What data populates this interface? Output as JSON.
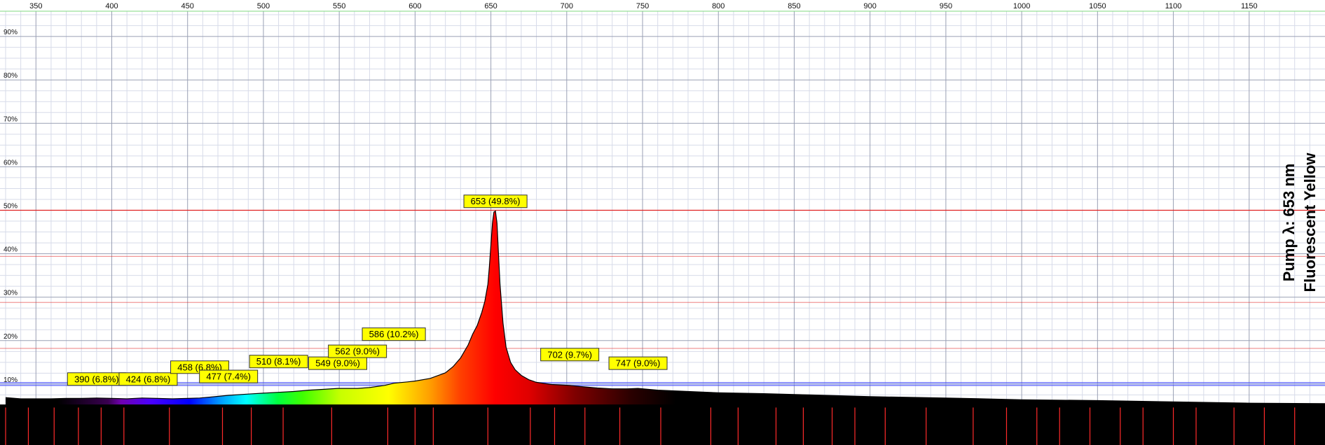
{
  "chart_data": {
    "type": "area",
    "title": "",
    "subtitle_lines": [
      "Pump λ: 653 nm",
      "Fluorescent Yellow"
    ],
    "xlabel": "",
    "ylabel": "",
    "x_axis": {
      "range": [
        330,
        1200
      ],
      "ticks": [
        350,
        400,
        450,
        500,
        550,
        600,
        650,
        700,
        750,
        800,
        850,
        900,
        950,
        1000,
        1050,
        1100,
        1150
      ],
      "tick_labels": [
        "350",
        "400",
        "450",
        "500",
        "550",
        "600",
        "650",
        "700",
        "750",
        "800",
        "850",
        "900",
        "950",
        "1000",
        "1050",
        "1100",
        "1150"
      ],
      "position": "top"
    },
    "y_axis": {
      "range": [
        0,
        100
      ],
      "ticks": [
        10,
        20,
        30,
        40,
        50,
        60,
        70,
        80,
        90
      ],
      "tick_labels": [
        "10%",
        "20%",
        "30%",
        "40%",
        "50%",
        "60%",
        "70%",
        "80%",
        "90%"
      ],
      "position": "left"
    },
    "grid": true,
    "reference_lines": {
      "red": [
        50,
        39.4,
        28.8,
        18.2
      ],
      "blue": [
        10
      ]
    },
    "series": [
      {
        "x": [
          330,
          340,
          350,
          360,
          370,
          380,
          390,
          400,
          410,
          420,
          430,
          440,
          450,
          458,
          465,
          477,
          490,
          500,
          510,
          520,
          530,
          540,
          549,
          555,
          562,
          570,
          580,
          586,
          595,
          600,
          610,
          620,
          625,
          630,
          635,
          638,
          641,
          644,
          646,
          648,
          649,
          650,
          651,
          652,
          653,
          654,
          655,
          656,
          658,
          660,
          663,
          666,
          670,
          675,
          680,
          690,
          702,
          710,
          720,
          730,
          740,
          747,
          760,
          780,
          800,
          830,
          860,
          900,
          950,
          1000,
          1050,
          1100,
          1150,
          1200
        ],
        "y": [
          6.9,
          6.6,
          6.6,
          6.6,
          6.7,
          6.7,
          6.8,
          6.7,
          6.6,
          6.8,
          6.7,
          6.6,
          6.7,
          6.8,
          7.0,
          7.4,
          7.7,
          7.9,
          8.1,
          8.3,
          8.6,
          8.8,
          9.0,
          9.0,
          9.0,
          9.2,
          9.7,
          10.2,
          10.5,
          10.7,
          11.3,
          12.6,
          14.0,
          16.0,
          19.0,
          21.5,
          23.5,
          26.5,
          29.0,
          33.0,
          37.0,
          42.0,
          47.0,
          49.6,
          49.8,
          47.0,
          40.0,
          33.0,
          24.0,
          18.5,
          15.0,
          13.3,
          12.0,
          11.0,
          10.4,
          9.9,
          9.7,
          9.4,
          9.1,
          8.9,
          8.9,
          9.0,
          8.6,
          8.3,
          8.0,
          7.8,
          7.5,
          7.1,
          6.8,
          6.4,
          6.2,
          5.9,
          5.6,
          5.5
        ]
      }
    ],
    "peaks": [
      {
        "x": 390,
        "y": 6.8,
        "label": "390 (6.8%)"
      },
      {
        "x": 424,
        "y": 6.8,
        "label": "424 (6.8%)"
      },
      {
        "x": 458,
        "y": 6.8,
        "label": "458 (6.8%)"
      },
      {
        "x": 477,
        "y": 7.4,
        "label": "477 (7.4%)"
      },
      {
        "x": 510,
        "y": 8.1,
        "label": "510 (8.1%)"
      },
      {
        "x": 549,
        "y": 9.0,
        "label": "549 (9.0%)"
      },
      {
        "x": 562,
        "y": 9.0,
        "label": "562 (9.0%)"
      },
      {
        "x": 586,
        "y": 10.2,
        "label": "586 (10.2%)"
      },
      {
        "x": 653,
        "y": 49.8,
        "label": "653 (49.8%)"
      },
      {
        "x": 702,
        "y": 9.7,
        "label": "702 (9.7%)"
      },
      {
        "x": 747,
        "y": 9.0,
        "label": "747 (9.0%)"
      }
    ],
    "bottom_markers": [
      330,
      345,
      362,
      378,
      393,
      408,
      438,
      473,
      492,
      513,
      545,
      582,
      600,
      612,
      648,
      676,
      692,
      712,
      735,
      762,
      795,
      813,
      838,
      856,
      875,
      890,
      910,
      937,
      968,
      990,
      1010,
      1025,
      1045,
      1065,
      1080,
      1100,
      1115,
      1140,
      1160,
      1180
    ],
    "colors": {
      "grid_major": "#9aa0b4",
      "grid_minor": "#d7dbe9",
      "reference_red": "#e02020",
      "reference_blue": "#2a2aff",
      "label_bg": "#ffff00",
      "label_border": "#333333",
      "baseline_fill": "#000000",
      "marker": "#ff2a2a",
      "top_border": "#7fd87f"
    }
  }
}
